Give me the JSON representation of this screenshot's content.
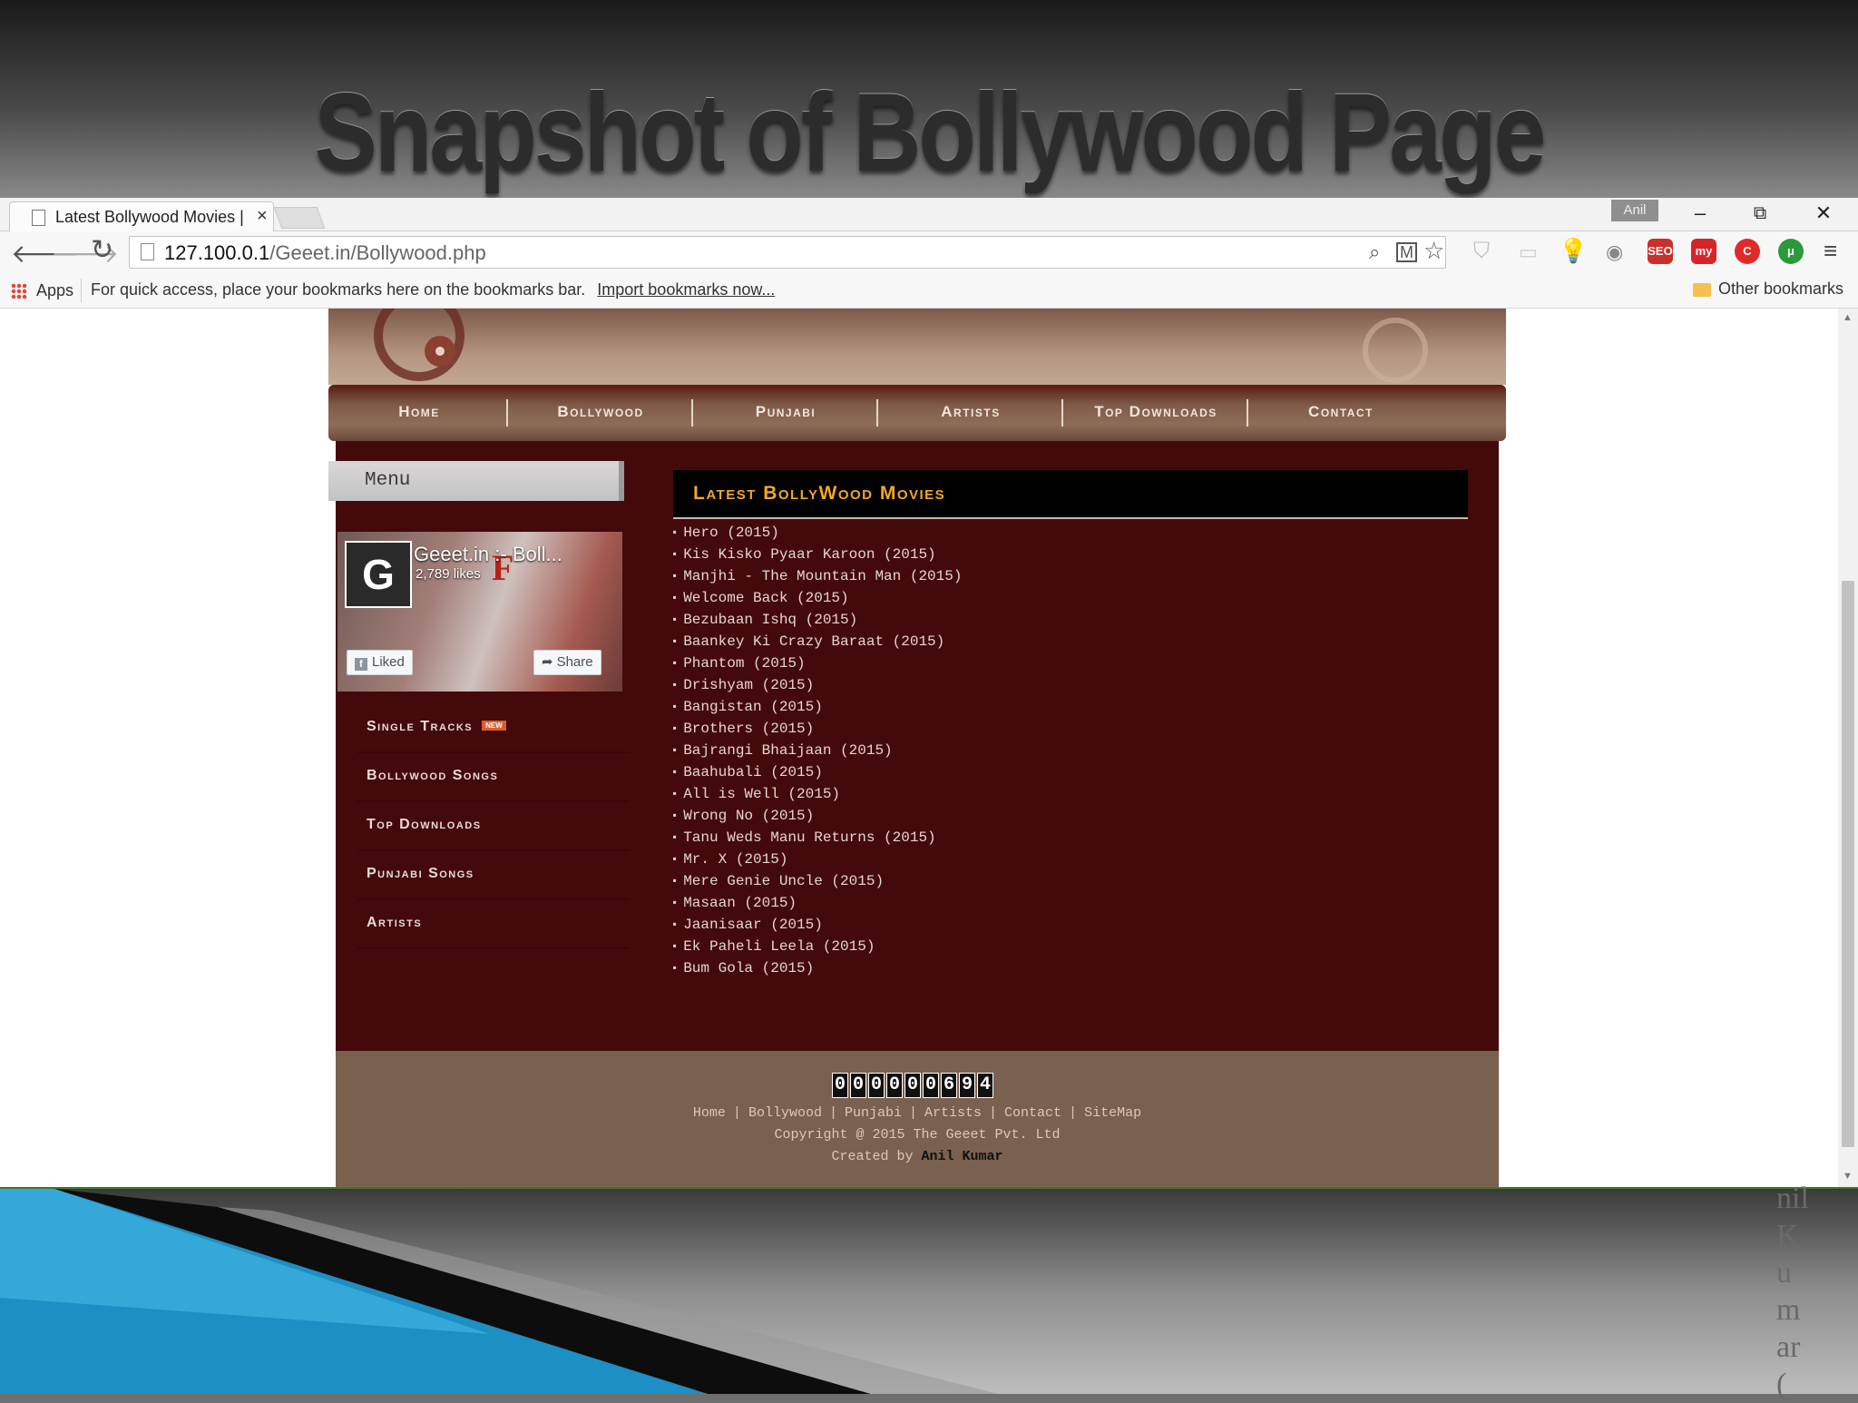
{
  "slide": {
    "title": "Snapshot of Bollywood Page",
    "side_letters": [
      "nil",
      "K",
      "u",
      "m",
      "ar",
      "("
    ]
  },
  "browser": {
    "tab_title": "Latest Bollywood Movies | ",
    "tab_close": "×",
    "profile_name": "Anil",
    "minimize": "–",
    "restore": "⧉",
    "close": "✕",
    "url_host": "127.100.0.1",
    "url_path": "/Geeet.in/Bollywood.php",
    "apps_label": "Apps",
    "bookmarks_hint": "For quick access, place your bookmarks here on the bookmarks bar.",
    "import_link": "Import bookmarks now...",
    "other_bookmarks": "Other bookmarks",
    "extensions": [
      {
        "name": "seo-icon",
        "label": "SEO",
        "color": "#c8302a"
      },
      {
        "name": "my-icon",
        "label": "my",
        "color": "#d8232a"
      },
      {
        "name": "shield-red-icon",
        "label": "C",
        "color": "#e02a2a"
      },
      {
        "name": "torrent-icon",
        "label": "μ",
        "color": "#2a9a3a"
      }
    ]
  },
  "site": {
    "nav": [
      "Home",
      "Bollywood",
      "Punjabi",
      "Artists",
      "Top Downloads",
      "Contact"
    ],
    "menu_label": "Menu",
    "fb_widget": {
      "page_name": "Geeet.in :- Boll...",
      "likes": "2,789 likes",
      "liked_label": "Liked",
      "share_label": "Share",
      "logo_letter": "G"
    },
    "side_menu": [
      {
        "label": "Single Tracks",
        "badge": "NEW"
      },
      {
        "label": "Bollywood Songs",
        "badge": ""
      },
      {
        "label": "Top Downloads",
        "badge": ""
      },
      {
        "label": "Punjabi Songs",
        "badge": ""
      },
      {
        "label": "Artists",
        "badge": ""
      }
    ],
    "heading": "Latest BollyWood Movies",
    "movies": [
      "Hero (2015)",
      "Kis Kisko Pyaar Karoon (2015)",
      "Manjhi - The Mountain Man (2015)",
      "Welcome Back (2015)",
      "Bezubaan Ishq (2015)",
      "Baankey Ki Crazy Baraat (2015)",
      "Phantom (2015)",
      "Drishyam (2015)",
      "Bangistan (2015)",
      "Brothers (2015)",
      "Bajrangi Bhaijaan (2015)",
      "Baahubali (2015)",
      "All is Well (2015)",
      "Wrong No (2015)",
      "Tanu Weds Manu Returns (2015)",
      "Mr. X (2015)",
      "Mere Genie Uncle (2015)",
      "Masaan (2015)",
      "Jaanisaar (2015)",
      "Ek Paheli Leela (2015)",
      "Bum Gola (2015)"
    ],
    "footer": {
      "counter": "000000694",
      "links": [
        "Home",
        "Bollywood",
        "Punjabi",
        "Artists",
        "Contact",
        "SiteMap"
      ],
      "copyright": "Copyright @ 2015 The Geeet Pvt. Ltd",
      "created_by_prefix": "Created by ",
      "author": "Anil Kumar"
    }
  },
  "colors": {
    "content_bg": "#44090b",
    "heading_gold": "#f2a728",
    "footer_bg": "#7a604f"
  }
}
